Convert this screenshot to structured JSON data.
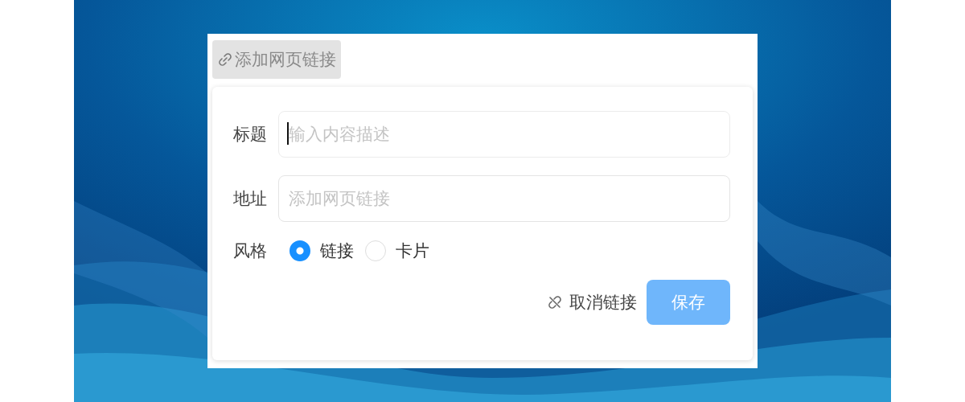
{
  "toolbar": {
    "link_button": "添加网页链接"
  },
  "form": {
    "fields": [
      {
        "label": "标题",
        "placeholder": "输入内容描述",
        "focused": true
      },
      {
        "label": "地址",
        "placeholder": "添加网页链接",
        "focused": false
      }
    ],
    "style": {
      "label": "风格",
      "options": [
        {
          "label": "链接",
          "selected": true
        },
        {
          "label": "卡片",
          "selected": false
        }
      ]
    }
  },
  "actions": {
    "unlink": "取消链接",
    "save": {
      "label": "保存",
      "disabled": true
    }
  }
}
